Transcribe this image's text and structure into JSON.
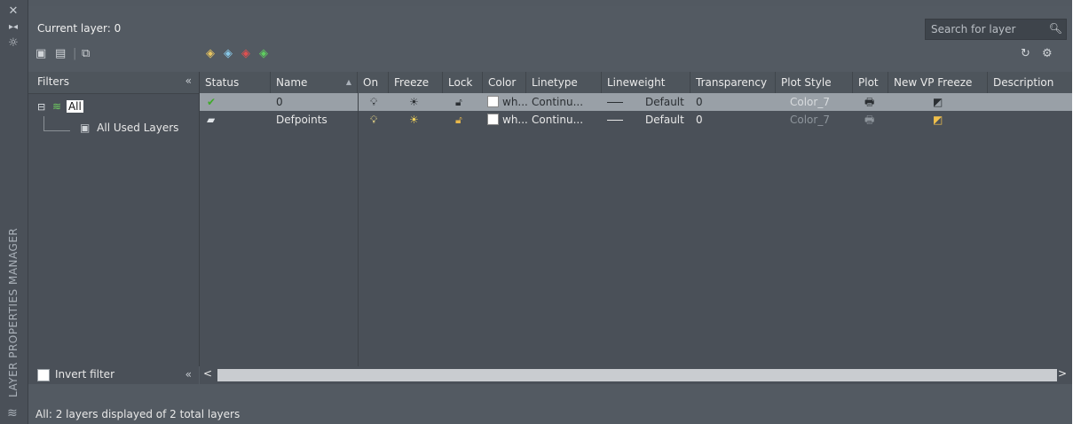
{
  "sidebar": {
    "title": "LAYER PROPERTIES MANAGER",
    "icons": [
      "close-icon",
      "auto-hide-icon",
      "properties-icon"
    ]
  },
  "header": {
    "current_layer": "Current layer: 0",
    "search_placeholder": "Search for layer"
  },
  "toolbar": {
    "left_icons": [
      "new-property-filter-icon",
      "new-group-filter-icon",
      "layer-states-manager-icon"
    ],
    "layer_icons": [
      "new-layer-icon",
      "new-layer-vp-frozen-icon",
      "delete-layer-icon",
      "set-current-icon"
    ],
    "right_icons": [
      "refresh-icon",
      "settings-icon"
    ]
  },
  "filters": {
    "header": "Filters",
    "collapse": "«",
    "tree": [
      {
        "label": "All",
        "selected": true
      },
      {
        "label": "All Used Layers",
        "selected": false
      }
    ],
    "invert_filter": "Invert filter",
    "invert_underline_char": "I"
  },
  "columns": [
    "Status",
    "Name",
    "On",
    "Freeze",
    "Lock",
    "Color",
    "Linetype",
    "Lineweight",
    "Transparency",
    "Plot Style",
    "Plot",
    "New VP Freeze",
    "Description"
  ],
  "layers": [
    {
      "status": "✔",
      "name": "0",
      "color": "wh...",
      "linetype": "Continu...",
      "lineweight": "Default",
      "transparency": "0",
      "plot_style": "Color_7",
      "selected": true
    },
    {
      "status": "▰",
      "name": "Defpoints",
      "color": "wh...",
      "linetype": "Continu...",
      "lineweight": "Default",
      "transparency": "0",
      "plot_style": "Color_7",
      "selected": false
    }
  ],
  "status_bar": "All: 2 layers displayed of 2 total layers",
  "scroll": {
    "left": "<",
    "right": ">"
  }
}
